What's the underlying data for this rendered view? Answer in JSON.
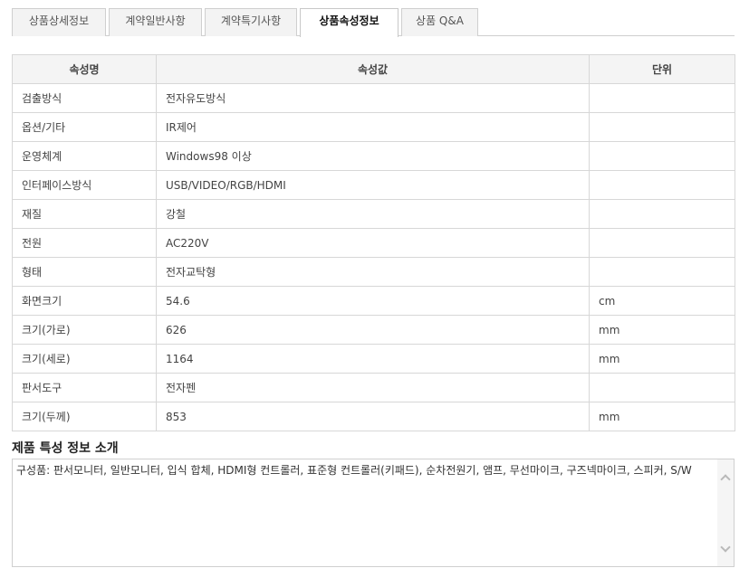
{
  "tabs": [
    {
      "label": "상품상세정보",
      "active": false
    },
    {
      "label": "계약일반사항",
      "active": false
    },
    {
      "label": "계약특기사항",
      "active": false
    },
    {
      "label": "상품속성정보",
      "active": true
    },
    {
      "label": "상품 Q&A",
      "active": false
    }
  ],
  "table": {
    "headers": [
      "속성명",
      "속성값",
      "단위"
    ],
    "rows": [
      [
        "검출방식",
        "전자유도방식",
        ""
      ],
      [
        "옵션/기타",
        "IR제어",
        ""
      ],
      [
        "운영체계",
        "Windows98 이상",
        ""
      ],
      [
        "인터페이스방식",
        "USB/VIDEO/RGB/HDMI",
        ""
      ],
      [
        "재질",
        "강철",
        ""
      ],
      [
        "전원",
        "AC220V",
        ""
      ],
      [
        "형태",
        "전자교탁형",
        ""
      ],
      [
        "화면크기",
        "54.6",
        "cm"
      ],
      [
        "크기(가로)",
        "626",
        "mm"
      ],
      [
        "크기(세로)",
        "1164",
        "mm"
      ],
      [
        "판서도구",
        "전자펜",
        ""
      ],
      [
        "크기(두께)",
        "853",
        "mm"
      ]
    ]
  },
  "intro": {
    "title": "제품 특성 정보 소개",
    "text": "구성품: 판서모니터, 일반모니터, 입식 합체, HDMI형 컨트롤러, 표준형 컨트롤러(키패드), 순차전원기, 앰프, 무선마이크, 구즈넥마이크, 스피커, S/W"
  }
}
